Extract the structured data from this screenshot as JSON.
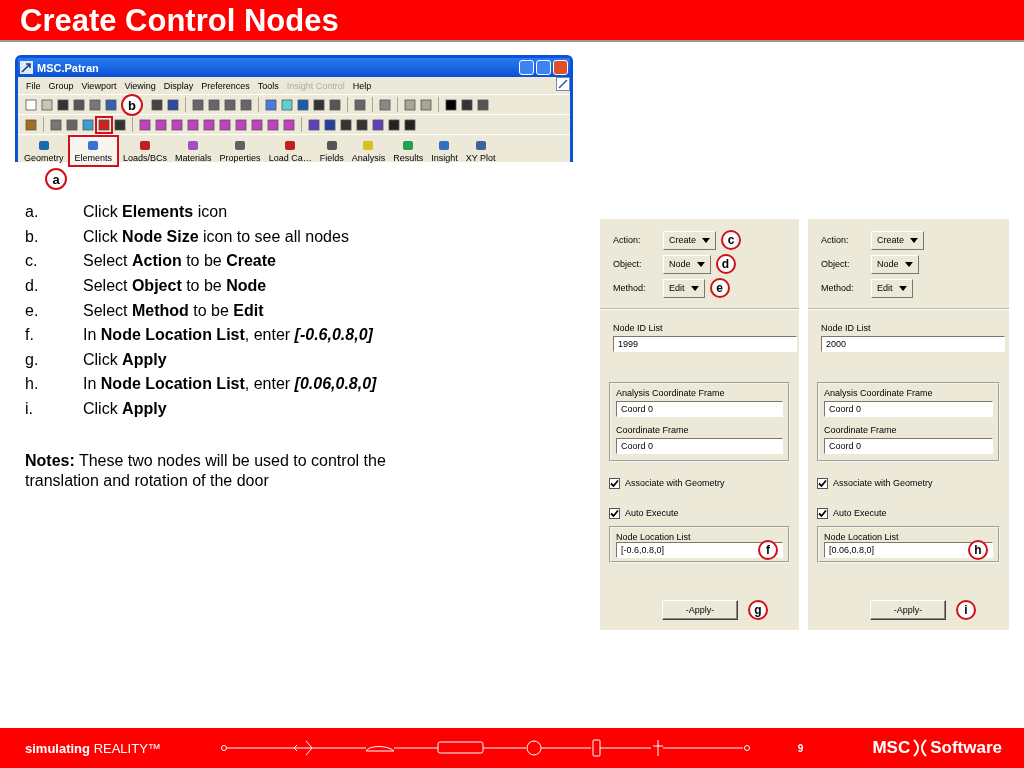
{
  "slide_title": "Create Control Nodes",
  "app_window": {
    "title": "MSC.Patran",
    "toolbar_callout": "b",
    "menu": [
      {
        "label": "File",
        "disabled": false
      },
      {
        "label": "Group",
        "disabled": false
      },
      {
        "label": "Viewport",
        "disabled": false
      },
      {
        "label": "Viewing",
        "disabled": false
      },
      {
        "label": "Display",
        "disabled": false
      },
      {
        "label": "Preferences",
        "disabled": false
      },
      {
        "label": "Tools",
        "disabled": false
      },
      {
        "label": "Insight Control",
        "disabled": true
      },
      {
        "label": "Help",
        "disabled": false
      }
    ],
    "tabs": [
      {
        "label": "Geometry",
        "highlighted": false
      },
      {
        "label": "Elements",
        "highlighted": true,
        "callout": "a"
      },
      {
        "label": "Loads/BCs",
        "highlighted": false
      },
      {
        "label": "Materials",
        "highlighted": false
      },
      {
        "label": "Properties",
        "highlighted": false
      },
      {
        "label": "Load Ca…",
        "highlighted": false
      },
      {
        "label": "Fields",
        "highlighted": false
      },
      {
        "label": "Analysis",
        "highlighted": false
      },
      {
        "label": "Results",
        "highlighted": false
      },
      {
        "label": "Insight",
        "highlighted": false
      },
      {
        "label": "XY Plot",
        "highlighted": false
      }
    ]
  },
  "steps": [
    {
      "marker": "a.",
      "text": "Click **Elements** icon"
    },
    {
      "marker": "b.",
      "text": "Click **Node Size** icon to see all nodes"
    },
    {
      "marker": "c.",
      "text": "Select **Action** to be **Create**"
    },
    {
      "marker": "d.",
      "text": "Select **Object** to be **Node**"
    },
    {
      "marker": "e.",
      "text": "Select **Method** to be **Edit**"
    },
    {
      "marker": "f.",
      "text": "In **Node Location List**, enter",
      "value": "[-0.6,0.8,0]"
    },
    {
      "marker": "g.",
      "text": "Click **Apply**"
    },
    {
      "marker": "h.",
      "text": "In **Node Location List**, enter",
      "value": "[0.06,0.8,0]"
    },
    {
      "marker": "i.",
      "text": "Click **Apply**"
    }
  ],
  "notes": "**Notes:** These two nodes will be used to control the translation and rotation of the door",
  "panels": [
    {
      "selectors": [
        {
          "label": "Action:",
          "value": "Create",
          "callout": "c"
        },
        {
          "label": "Object:",
          "value": "Node",
          "callout": "d"
        },
        {
          "label": "Method:",
          "value": "Edit",
          "callout": "e"
        }
      ],
      "node_id_label": "Node ID List",
      "node_id": "1999",
      "frames": [
        {
          "label": "Analysis Coordinate Frame",
          "value": "Coord 0"
        },
        {
          "label": "Coordinate Frame",
          "value": "Coord 0"
        }
      ],
      "checks": [
        {
          "label": "Associate with Geometry",
          "checked": true
        },
        {
          "label": "Auto Execute",
          "checked": true
        }
      ],
      "location_label": "Node Location List",
      "location": "[-0.6,0.8,0]",
      "location_callout": "f",
      "apply": "-Apply-",
      "apply_callout": "g"
    },
    {
      "selectors": [
        {
          "label": "Action:",
          "value": "Create"
        },
        {
          "label": "Object:",
          "value": "Node"
        },
        {
          "label": "Method:",
          "value": "Edit"
        }
      ],
      "node_id_label": "Node ID List",
      "node_id": "2000",
      "frames": [
        {
          "label": "Analysis Coordinate Frame",
          "value": "Coord 0"
        },
        {
          "label": "Coordinate Frame",
          "value": "Coord 0"
        }
      ],
      "checks": [
        {
          "label": "Associate with Geometry",
          "checked": true
        },
        {
          "label": "Auto Execute",
          "checked": true
        }
      ],
      "location_label": "Node Location List",
      "location": "[0.06,0.8,0]",
      "location_callout": "h",
      "apply": "-Apply-",
      "apply_callout": "i"
    }
  ],
  "footer": {
    "tagline": "**simulating** REALITY™",
    "page": "9",
    "logo_left": "MSC",
    "logo_right": "Software"
  }
}
